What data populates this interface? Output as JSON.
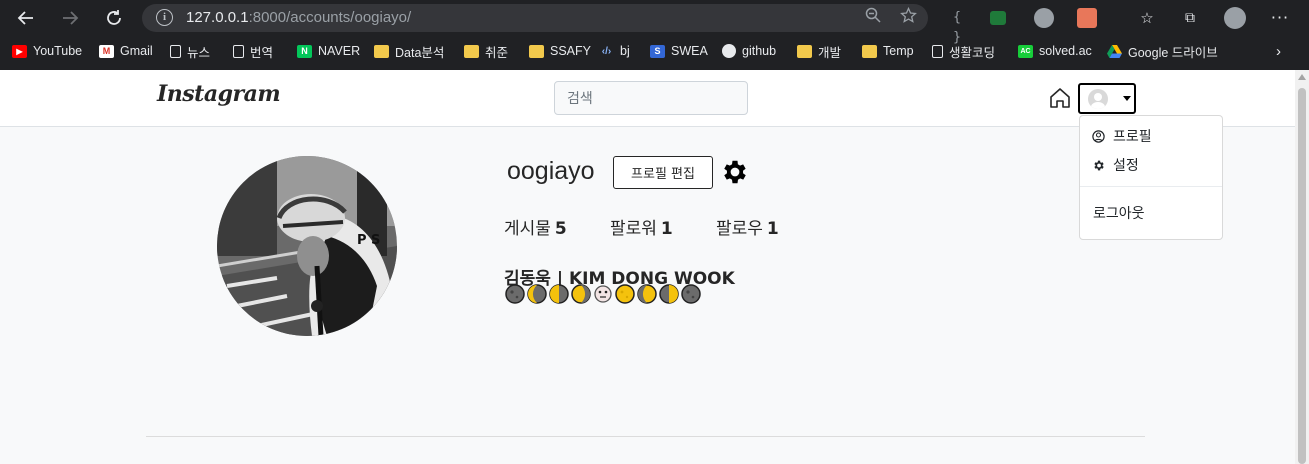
{
  "browser": {
    "url_host": "127.0.0.1",
    "url_rest": ":8000/accounts/oogiayo/",
    "bookmarks": [
      {
        "label": "YouTube",
        "icon": "youtube-icon"
      },
      {
        "label": "Gmail",
        "icon": "gmail-icon"
      },
      {
        "label": "뉴스",
        "icon": "page-icon"
      },
      {
        "label": "번역",
        "icon": "page-icon"
      },
      {
        "label": "NAVER",
        "icon": "naver-icon"
      },
      {
        "label": "Data분석",
        "icon": "folder-icon"
      },
      {
        "label": "취준",
        "icon": "folder-icon"
      },
      {
        "label": "SSAFY",
        "icon": "folder-icon"
      },
      {
        "label": "bj",
        "icon": "code-icon"
      },
      {
        "label": "SWEA",
        "icon": "swea-icon"
      },
      {
        "label": "github",
        "icon": "github-icon"
      },
      {
        "label": "개발",
        "icon": "folder-icon"
      },
      {
        "label": "Temp",
        "icon": "folder-icon"
      },
      {
        "label": "생활코딩",
        "icon": "page-icon"
      },
      {
        "label": "solved.ac",
        "icon": "solvedac-icon"
      },
      {
        "label": "Google 드라이브",
        "icon": "gdrive-icon"
      }
    ]
  },
  "navbar": {
    "logo": "Instagram",
    "search_placeholder": "검색"
  },
  "dropdown": {
    "profile": "프로필",
    "settings": "설정",
    "logout": "로그아웃"
  },
  "profile": {
    "username": "oogiayo",
    "edit_button": "프로필 편집",
    "posts_label": "게시물",
    "posts_count": "5",
    "followers_label": "팔로워",
    "followers_count": "1",
    "following_label": "팔로우",
    "following_count": "1",
    "fullname": "김동욱 | KIM DONG WOOK",
    "bio_emojis": [
      "new-moon",
      "waning-crescent",
      "last-quarter",
      "waning-gibbous",
      "monkey",
      "full-moon",
      "waxing-gibbous",
      "first-quarter",
      "new-moon"
    ]
  },
  "colors": {
    "browser_bg": "#202124",
    "page_bg": "#f8f9fa",
    "text": "#262626"
  }
}
